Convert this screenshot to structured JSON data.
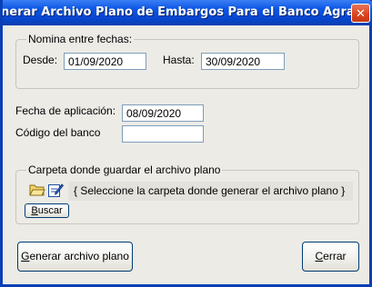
{
  "window": {
    "title": "nerar Archivo Plano de Embargos Para el Banco Agra",
    "close_icon": "close-icon"
  },
  "date_range": {
    "legend": "Nomina entre fechas:",
    "from_label": "Desde:",
    "from_value": "01/09/2020",
    "to_label": "Hasta:",
    "to_value": "30/09/2020"
  },
  "application_date": {
    "label": "Fecha de aplicación:",
    "value": "08/09/2020"
  },
  "bank_code": {
    "label": "Código del banco",
    "value": ""
  },
  "folder": {
    "legend": "Carpeta donde guardar el archivo plano",
    "open_icon": "folder-open-icon",
    "edit_icon": "edit-icon",
    "hint": "{ Seleccione la carpeta donde generar el archivo plano }",
    "search_button": {
      "mnemonic": "B",
      "rest": "uscar"
    }
  },
  "actions": {
    "generate_button": {
      "mnemonic": "G",
      "rest": "enerar archivo plano"
    },
    "close_button": {
      "mnemonic": "C",
      "rest": "errar"
    }
  },
  "colors": {
    "title_bar": "#0c56e3",
    "window_bg": "#ecebe6",
    "close_button": "#d9431c"
  }
}
